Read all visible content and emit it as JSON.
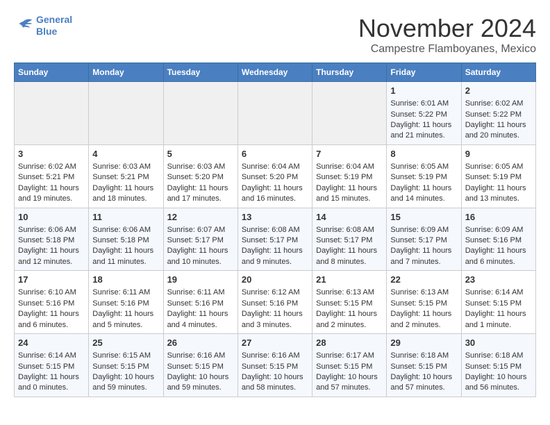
{
  "header": {
    "logo_line1": "General",
    "logo_line2": "Blue",
    "month": "November 2024",
    "location": "Campestre Flamboyanes, Mexico"
  },
  "weekdays": [
    "Sunday",
    "Monday",
    "Tuesday",
    "Wednesday",
    "Thursday",
    "Friday",
    "Saturday"
  ],
  "weeks": [
    [
      {
        "day": "",
        "empty": true
      },
      {
        "day": "",
        "empty": true
      },
      {
        "day": "",
        "empty": true
      },
      {
        "day": "",
        "empty": true
      },
      {
        "day": "",
        "empty": true
      },
      {
        "day": "1",
        "sunrise": "6:01 AM",
        "sunset": "5:22 PM",
        "daylight": "11 hours and 21 minutes."
      },
      {
        "day": "2",
        "sunrise": "6:02 AM",
        "sunset": "5:22 PM",
        "daylight": "11 hours and 20 minutes."
      }
    ],
    [
      {
        "day": "3",
        "sunrise": "6:02 AM",
        "sunset": "5:21 PM",
        "daylight": "11 hours and 19 minutes."
      },
      {
        "day": "4",
        "sunrise": "6:03 AM",
        "sunset": "5:21 PM",
        "daylight": "11 hours and 18 minutes."
      },
      {
        "day": "5",
        "sunrise": "6:03 AM",
        "sunset": "5:20 PM",
        "daylight": "11 hours and 17 minutes."
      },
      {
        "day": "6",
        "sunrise": "6:04 AM",
        "sunset": "5:20 PM",
        "daylight": "11 hours and 16 minutes."
      },
      {
        "day": "7",
        "sunrise": "6:04 AM",
        "sunset": "5:19 PM",
        "daylight": "11 hours and 15 minutes."
      },
      {
        "day": "8",
        "sunrise": "6:05 AM",
        "sunset": "5:19 PM",
        "daylight": "11 hours and 14 minutes."
      },
      {
        "day": "9",
        "sunrise": "6:05 AM",
        "sunset": "5:19 PM",
        "daylight": "11 hours and 13 minutes."
      }
    ],
    [
      {
        "day": "10",
        "sunrise": "6:06 AM",
        "sunset": "5:18 PM",
        "daylight": "11 hours and 12 minutes."
      },
      {
        "day": "11",
        "sunrise": "6:06 AM",
        "sunset": "5:18 PM",
        "daylight": "11 hours and 11 minutes."
      },
      {
        "day": "12",
        "sunrise": "6:07 AM",
        "sunset": "5:17 PM",
        "daylight": "11 hours and 10 minutes."
      },
      {
        "day": "13",
        "sunrise": "6:08 AM",
        "sunset": "5:17 PM",
        "daylight": "11 hours and 9 minutes."
      },
      {
        "day": "14",
        "sunrise": "6:08 AM",
        "sunset": "5:17 PM",
        "daylight": "11 hours and 8 minutes."
      },
      {
        "day": "15",
        "sunrise": "6:09 AM",
        "sunset": "5:17 PM",
        "daylight": "11 hours and 7 minutes."
      },
      {
        "day": "16",
        "sunrise": "6:09 AM",
        "sunset": "5:16 PM",
        "daylight": "11 hours and 6 minutes."
      }
    ],
    [
      {
        "day": "17",
        "sunrise": "6:10 AM",
        "sunset": "5:16 PM",
        "daylight": "11 hours and 6 minutes."
      },
      {
        "day": "18",
        "sunrise": "6:11 AM",
        "sunset": "5:16 PM",
        "daylight": "11 hours and 5 minutes."
      },
      {
        "day": "19",
        "sunrise": "6:11 AM",
        "sunset": "5:16 PM",
        "daylight": "11 hours and 4 minutes."
      },
      {
        "day": "20",
        "sunrise": "6:12 AM",
        "sunset": "5:16 PM",
        "daylight": "11 hours and 3 minutes."
      },
      {
        "day": "21",
        "sunrise": "6:13 AM",
        "sunset": "5:15 PM",
        "daylight": "11 hours and 2 minutes."
      },
      {
        "day": "22",
        "sunrise": "6:13 AM",
        "sunset": "5:15 PM",
        "daylight": "11 hours and 2 minutes."
      },
      {
        "day": "23",
        "sunrise": "6:14 AM",
        "sunset": "5:15 PM",
        "daylight": "11 hours and 1 minute."
      }
    ],
    [
      {
        "day": "24",
        "sunrise": "6:14 AM",
        "sunset": "5:15 PM",
        "daylight": "11 hours and 0 minutes."
      },
      {
        "day": "25",
        "sunrise": "6:15 AM",
        "sunset": "5:15 PM",
        "daylight": "10 hours and 59 minutes."
      },
      {
        "day": "26",
        "sunrise": "6:16 AM",
        "sunset": "5:15 PM",
        "daylight": "10 hours and 59 minutes."
      },
      {
        "day": "27",
        "sunrise": "6:16 AM",
        "sunset": "5:15 PM",
        "daylight": "10 hours and 58 minutes."
      },
      {
        "day": "28",
        "sunrise": "6:17 AM",
        "sunset": "5:15 PM",
        "daylight": "10 hours and 57 minutes."
      },
      {
        "day": "29",
        "sunrise": "6:18 AM",
        "sunset": "5:15 PM",
        "daylight": "10 hours and 57 minutes."
      },
      {
        "day": "30",
        "sunrise": "6:18 AM",
        "sunset": "5:15 PM",
        "daylight": "10 hours and 56 minutes."
      }
    ]
  ]
}
